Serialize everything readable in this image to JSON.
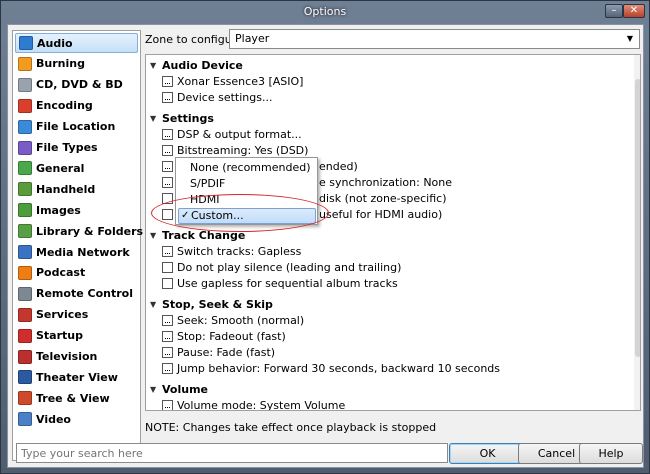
{
  "window": {
    "title": "Options"
  },
  "sidebar": {
    "items": [
      {
        "label": "Audio",
        "icon": "audio-icon",
        "color": "#2f7bd0",
        "selected": true
      },
      {
        "label": "Burning",
        "icon": "burning-icon",
        "color": "#f39b1e"
      },
      {
        "label": "CD, DVD & BD",
        "icon": "disc-icon",
        "color": "#9aa3ad"
      },
      {
        "label": "Encoding",
        "icon": "encoding-icon",
        "color": "#d9402b"
      },
      {
        "label": "File Location",
        "icon": "file-location-icon",
        "color": "#3a8ad8"
      },
      {
        "label": "File Types",
        "icon": "file-types-icon",
        "color": "#7a5cc7"
      },
      {
        "label": "General",
        "icon": "general-icon",
        "color": "#4aa84a"
      },
      {
        "label": "Handheld",
        "icon": "handheld-icon",
        "color": "#5a9c3c"
      },
      {
        "label": "Images",
        "icon": "images-icon",
        "color": "#4c9e3a"
      },
      {
        "label": "Library & Folders",
        "icon": "library-icon",
        "color": "#58a046"
      },
      {
        "label": "Media Network",
        "icon": "media-network-icon",
        "color": "#3a73c2"
      },
      {
        "label": "Podcast",
        "icon": "podcast-icon",
        "color": "#f07c14"
      },
      {
        "label": "Remote Control",
        "icon": "remote-control-icon",
        "color": "#7d8892"
      },
      {
        "label": "Services",
        "icon": "services-icon",
        "color": "#c4372d"
      },
      {
        "label": "Startup",
        "icon": "startup-icon",
        "color": "#d02d2d"
      },
      {
        "label": "Television",
        "icon": "television-icon",
        "color": "#b9302e"
      },
      {
        "label": "Theater View",
        "icon": "theater-view-icon",
        "color": "#2c5aa0"
      },
      {
        "label": "Tree & View",
        "icon": "tree-view-icon",
        "color": "#cf4a2a"
      },
      {
        "label": "Video",
        "icon": "video-icon",
        "color": "#4b7fc7"
      }
    ]
  },
  "zone": {
    "label": "Zone to configure:",
    "value": "Player"
  },
  "sections": {
    "audio_device": "Audio Device",
    "settings": "Settings",
    "track_change": "Track Change",
    "stop_seek_skip": "Stop, Seek & Skip",
    "volume": "Volume"
  },
  "rows": {
    "device": "Xonar Essence3 [ASIO]",
    "device_settings": "Device settings...",
    "dsp": "DSP & output format...",
    "bitstreaming": "Bitstreaming: Yes (DSD)",
    "row3_tail": "ended)",
    "row4_tail": "e synchronization: None",
    "row5_tail": "disk (not zone-specific)",
    "row6_tail": "useful for HDMI audio)",
    "switch_tracks": "Switch tracks: Gapless",
    "no_silence": "Do not play silence (leading and trailing)",
    "gapless_sequential": "Use gapless for sequential album tracks",
    "seek": "Seek: Smooth (normal)",
    "stop": "Stop: Fadeout (fast)",
    "pause": "Pause: Fade (fast)",
    "jump": "Jump behavior: Forward 30 seconds, backward 10 seconds",
    "volume_mode": "Volume mode: System Volume"
  },
  "menu": {
    "items": [
      {
        "label": "None (recommended)",
        "checked": false
      },
      {
        "label": "S/PDIF",
        "checked": false
      },
      {
        "label": "HDMI",
        "checked": false
      },
      {
        "label": "Custom...",
        "checked": true
      }
    ],
    "check_glyph": "✓"
  },
  "note": "NOTE: Changes take effect once playback is stopped",
  "search": {
    "placeholder": "Type your search here"
  },
  "buttons": {
    "ok": "OK",
    "cancel": "Cancel",
    "help": "Help"
  },
  "titlebar_buttons": {
    "minimize": "–",
    "close": "✕"
  }
}
